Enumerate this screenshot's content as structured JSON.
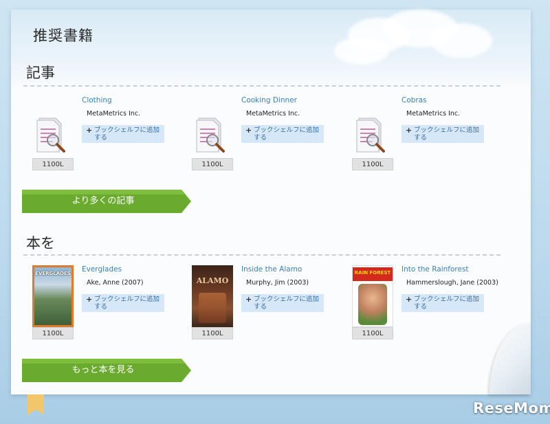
{
  "page": {
    "title": "推奨書籍"
  },
  "articles": {
    "heading": "記事",
    "items": [
      {
        "title": "Clothing",
        "meta": "MetaMetrics Inc.",
        "add_label": "ブックシェルフに追加する",
        "level": "1100L"
      },
      {
        "title": "Cooking Dinner",
        "meta": "MetaMetrics Inc.",
        "add_label": "ブックシェルフに追加する",
        "level": "1100L"
      },
      {
        "title": "Cobras",
        "meta": "MetaMetrics Inc.",
        "add_label": "ブックシェルフに追加する",
        "level": "1100L"
      }
    ],
    "more_label": "より多くの記事"
  },
  "books": {
    "heading": "本を",
    "items": [
      {
        "title": "Everglades",
        "meta": "Ake, Anne (2007)",
        "add_label": "ブックシェルフに追加する",
        "level": "1100L",
        "cover_text": "EVERGLADES"
      },
      {
        "title": "Inside the Alamo",
        "meta": "Murphy, Jim (2003)",
        "add_label": "ブックシェルフに追加する",
        "level": "1100L",
        "cover_text": "ALAMO"
      },
      {
        "title": "Into the Rainforest",
        "meta": "Hammerslough, Jane (2003)",
        "add_label": "ブックシェルフに追加する",
        "level": "1100L",
        "cover_text": "RAIN FOREST"
      }
    ],
    "more_label": "もっと本を見る"
  },
  "brand": {
    "logo_text": "ReseMom"
  },
  "colors": {
    "link": "#3a7fb8",
    "button_green": "#6aaa2e",
    "add_button_bg": "#d6e8f7"
  },
  "icons": {
    "article_thumb": "document-magnifier-icon",
    "add": "plus-icon",
    "more_arrow": "arrow-banner-icon"
  }
}
